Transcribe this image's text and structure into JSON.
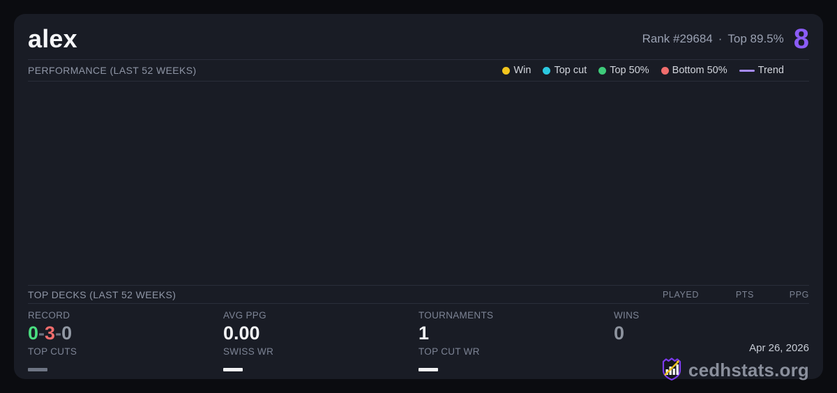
{
  "header": {
    "player_name": "alex",
    "rank_text": "Rank #29684",
    "separator": "·",
    "top_percent_text": "Top 89.5%",
    "points": "8",
    "points_color": "#8b5cf6"
  },
  "performance": {
    "title": "PERFORMANCE (LAST 52 WEEKS)",
    "legend": [
      {
        "label": "Win",
        "marker": "dot",
        "color": "#f2c51d"
      },
      {
        "label": "Top cut",
        "marker": "dot",
        "color": "#2bc8e0"
      },
      {
        "label": "Top 50%",
        "marker": "dot",
        "color": "#3ecb7a"
      },
      {
        "label": "Bottom 50%",
        "marker": "dot",
        "color": "#f16d6d"
      },
      {
        "label": "Trend",
        "marker": "line",
        "color": "#a78bfa"
      }
    ],
    "chart_empty": true
  },
  "top_decks": {
    "title": "TOP DECKS (LAST 52 WEEKS)",
    "columns": [
      "PLAYED",
      "PTS",
      "PPG"
    ]
  },
  "stats": {
    "record": {
      "label": "RECORD",
      "wins": "0",
      "losses": "3",
      "draws": "0",
      "separator": "-",
      "wins_color": "#4ade80",
      "losses_color": "#f16d6d",
      "draws_color": "#9299a4"
    },
    "avg_ppg": {
      "label": "AVG PPG",
      "value": "0.00"
    },
    "tournaments": {
      "label": "TOURNAMENTS",
      "value": "1"
    },
    "wins": {
      "label": "WINS",
      "value": "0",
      "value_color": "#8d939e"
    },
    "top_cuts": {
      "label": "TOP CUTS",
      "value": "—",
      "dash_color": "#6e7584"
    },
    "swiss_wr": {
      "label": "SWISS WR",
      "value": "—",
      "dash_color": "#f3f4f6"
    },
    "top_cut_wr": {
      "label": "TOP CUT WR",
      "value": "—",
      "dash_color": "#f3f4f6"
    }
  },
  "footer": {
    "date": "Apr 26, 2026",
    "brand": "cedhstats.org"
  },
  "icons": {
    "brand": "shield-bar-chart-arrow-icon"
  },
  "colors": {
    "page_bg": "#0b0c10",
    "card_bg": "#191c25",
    "divider": "#2a2e3a",
    "accent_purple": "#8b5cf6",
    "logo_purple": "#7c3aed",
    "logo_gold": "#f0c420"
  }
}
